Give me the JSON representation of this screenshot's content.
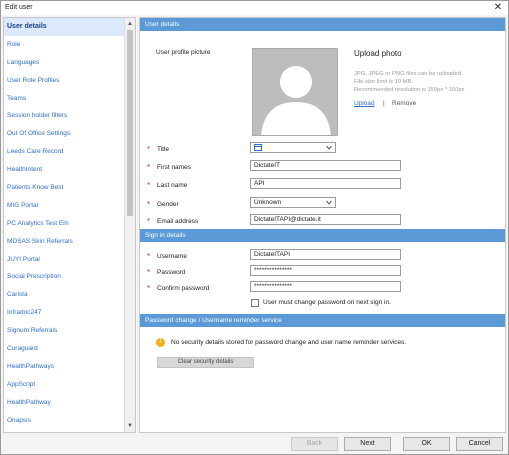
{
  "window": {
    "title": "Edit user",
    "close_glyph": "✕"
  },
  "sidebar": {
    "items": [
      {
        "label": "User details",
        "active": true
      },
      {
        "label": "Role"
      },
      {
        "label": "Languages"
      },
      {
        "label": "User Role Profiles"
      },
      {
        "label": "Teams"
      },
      {
        "label": "Session holder filters"
      },
      {
        "label": "Out Of Office Settings"
      },
      {
        "label": "Leeds Care Record"
      },
      {
        "label": "HealthIntent"
      },
      {
        "label": "Patients Know Best"
      },
      {
        "label": "MIG Portal"
      },
      {
        "label": "PC Analytics Test Em"
      },
      {
        "label": "MDSAS Skin Referrals"
      },
      {
        "label": "JUYI Portal"
      },
      {
        "label": "Social Prescription"
      },
      {
        "label": "Carista"
      },
      {
        "label": "Infradoc247"
      },
      {
        "label": "Signum Referrals"
      },
      {
        "label": "Curaguard"
      },
      {
        "label": "HealthPathways"
      },
      {
        "label": "AppScript"
      },
      {
        "label": "HealthPathway"
      },
      {
        "label": "Onapsis"
      }
    ],
    "scroll_up_glyph": "▲",
    "scroll_down_glyph": "▼"
  },
  "user_details": {
    "header": "User details",
    "profile_picture_label": "User profile picture",
    "upload_title": "Upload photo",
    "upload_hint_1": "JPG, JPEG or PNG files can be uploaded.",
    "upload_hint_2": "File size limit is 10 MB.",
    "upload_hint_3": "Recommended resolution is 150px * 150px",
    "upload_link": "Upload",
    "separator": "|",
    "remove_link": "Remove",
    "title_label": "Title",
    "title_value": "",
    "first_names_label": "First names",
    "first_names_value": "DictateIT",
    "last_name_label": "Last name",
    "last_name_value": "API",
    "gender_label": "Gender",
    "gender_value": "Unknown",
    "email_label": "Email address",
    "email_value": "DictateITAPI@dictate.it",
    "required_mark": "*"
  },
  "sign_in": {
    "header": "Sign in details",
    "username_label": "Username",
    "username_value": "DictateITAPI",
    "password_label": "Password",
    "password_value": "***************",
    "confirm_label": "Confirm password",
    "confirm_value": "***************",
    "must_change_label": "User must change password on next sign in.",
    "must_change_checked": false
  },
  "security": {
    "header": "Password change / Username reminder service",
    "info_glyph": "!",
    "message": "No security details stored for password change and user name reminder services.",
    "clear_button": "Clear security details"
  },
  "footer": {
    "back": "Back",
    "next": "Next",
    "ok": "OK",
    "cancel": "Cancel"
  },
  "colors": {
    "section_header": "#5b9ad6",
    "link": "#2f6fd0",
    "required": "#d9342b",
    "info": "#f2b21a"
  }
}
